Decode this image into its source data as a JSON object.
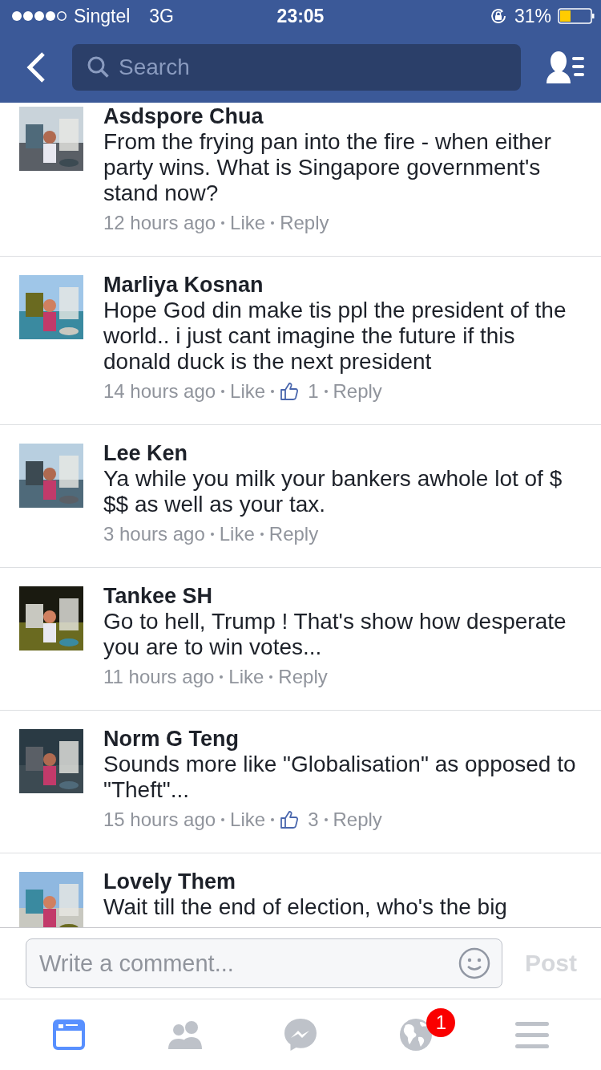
{
  "status_bar": {
    "carrier": "Singtel",
    "network": "3G",
    "time": "23:05",
    "battery": "31%"
  },
  "nav": {
    "search": {
      "placeholder": "Search"
    }
  },
  "comments": [
    {
      "name": "Asdspore Chua",
      "text": "From the frying pan into the fire - when either party wins. What is Singapore government's stand now?",
      "time": "12 hours ago",
      "like": "Like",
      "reply": "Reply"
    },
    {
      "name": "Marliya Kosnan",
      "text": "Hope God din make tis ppl the president of the world.. i just cant imagine the future if this donald duck is the next president",
      "time": "14 hours ago",
      "like": "Like",
      "likes": "1",
      "reply": "Reply"
    },
    {
      "name": "Lee Ken",
      "text": "Ya while you milk your bankers awhole lot of $ $$ as well as your tax.",
      "time": "3 hours ago",
      "like": "Like",
      "reply": "Reply"
    },
    {
      "name": "Tankee SH",
      "text": "Go to hell, Trump ! That's show how desperate you are to win votes...",
      "time": "11 hours ago",
      "like": "Like",
      "reply": "Reply"
    },
    {
      "name": "Norm G Teng",
      "text": "Sounds more like \"Globalisation\" as opposed to \"Theft\"...",
      "time": "15 hours ago",
      "like": "Like",
      "likes": "3",
      "reply": "Reply"
    },
    {
      "name": "Lovely Them",
      "text": "Wait till the end of election, who's the big"
    }
  ],
  "composer": {
    "placeholder": "Write a comment...",
    "post": "Post"
  },
  "tabs": [
    {
      "kind": "feed",
      "selected": true
    },
    {
      "kind": "friends",
      "selected": false
    },
    {
      "kind": "messenger",
      "selected": false
    },
    {
      "kind": "notifications",
      "selected": false,
      "badge": "1"
    },
    {
      "kind": "menu",
      "selected": false
    }
  ]
}
